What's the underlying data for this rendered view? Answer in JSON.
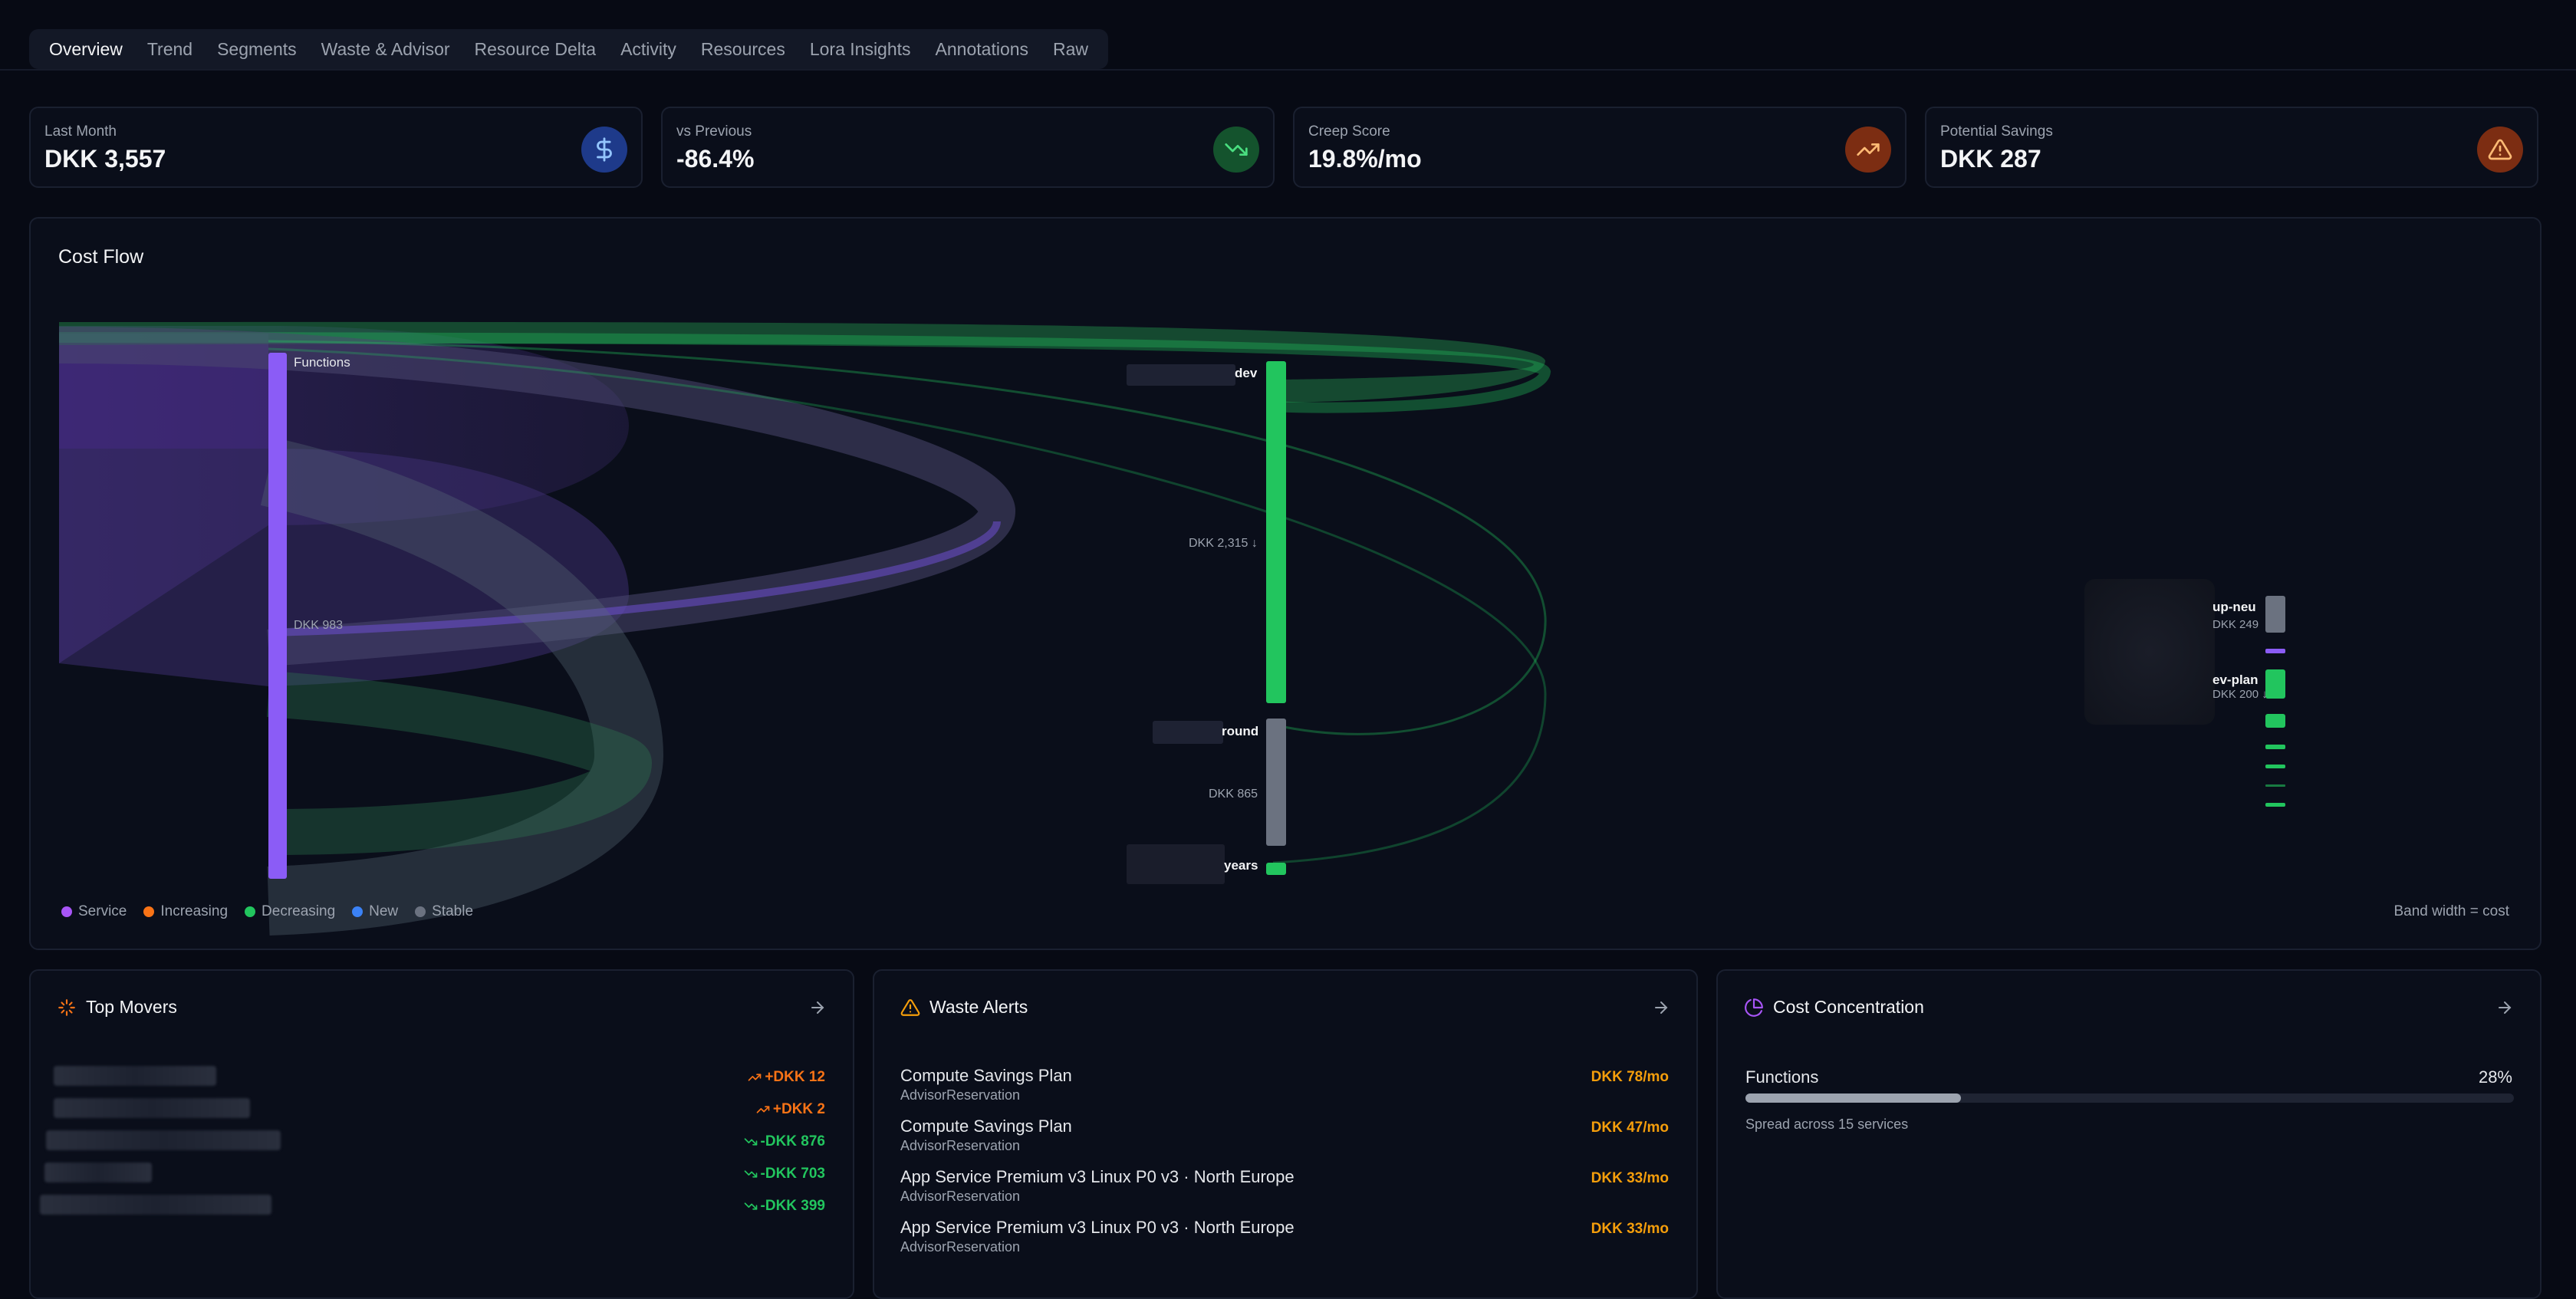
{
  "tabs": [
    "Overview",
    "Trend",
    "Segments",
    "Waste & Advisor",
    "Resource Delta",
    "Activity",
    "Resources",
    "Lora Insights",
    "Annotations",
    "Raw"
  ],
  "active_tab": "Overview",
  "kpis": [
    {
      "label": "Last Month",
      "value": "DKK 3,557",
      "icon": "dollar-icon",
      "color": "#1e3a8a",
      "icon_color": "#93c5fd"
    },
    {
      "label": "vs Previous",
      "value": "-86.4%",
      "icon": "trending-down-icon",
      "color": "#14532d",
      "icon_color": "#4ade80"
    },
    {
      "label": "Creep Score",
      "value": "19.8%/mo",
      "icon": "trending-up-icon",
      "color": "#7c2d12",
      "icon_color": "#fdba74"
    },
    {
      "label": "Potential Savings",
      "value": "DKK 287",
      "icon": "warning-icon",
      "color": "#7c2d12",
      "icon_color": "#fdba74"
    }
  ],
  "cost_flow": {
    "title": "Cost Flow",
    "nodes": {
      "functions": {
        "label": "Functions",
        "value": "DKK 983"
      },
      "dev": {
        "label": "dev",
        "value": "DKK 2,315 ↓"
      },
      "round": {
        "label": "round",
        "value": "DKK 865"
      },
      "years": {
        "label": "years"
      },
      "up_neu": {
        "label": "up-neu",
        "value": "DKK 249"
      },
      "ev_plan": {
        "label": "ev-plan",
        "value": "DKK 200 ↓"
      }
    },
    "legend": [
      {
        "label": "Service",
        "color": "#a855f7"
      },
      {
        "label": "Increasing",
        "color": "#f97316"
      },
      {
        "label": "Decreasing",
        "color": "#22c55e"
      },
      {
        "label": "New",
        "color": "#3b82f6"
      },
      {
        "label": "Stable",
        "color": "#6b7280"
      }
    ],
    "note": "Band width = cost"
  },
  "top_movers": {
    "title": "Top Movers",
    "items": [
      {
        "value": "+DKK 12",
        "dir": "up",
        "color": "#f97316"
      },
      {
        "value": "+DKK 2",
        "dir": "up",
        "color": "#f97316"
      },
      {
        "value": "-DKK 876",
        "dir": "down",
        "color": "#22c55e"
      },
      {
        "value": "-DKK 703",
        "dir": "down",
        "color": "#22c55e"
      },
      {
        "value": "-DKK 399",
        "dir": "down",
        "color": "#22c55e"
      }
    ]
  },
  "waste_alerts": {
    "title": "Waste Alerts",
    "items": [
      {
        "title": "Compute Savings Plan",
        "sub": "AdvisorReservation",
        "amount": "DKK 78/mo"
      },
      {
        "title": "Compute Savings Plan",
        "sub": "AdvisorReservation",
        "amount": "DKK 47/mo"
      },
      {
        "title": "App Service Premium v3 Linux P0 v3 · North Europe",
        "sub": "AdvisorReservation",
        "amount": "DKK 33/mo"
      },
      {
        "title": "App Service Premium v3 Linux P0 v3 · North Europe",
        "sub": "AdvisorReservation",
        "amount": "DKK 33/mo"
      }
    ]
  },
  "cost_concentration": {
    "title": "Cost Concentration",
    "label": "Functions",
    "pct_text": "28%",
    "pct": 0.28,
    "note": "Spread across 15 services"
  }
}
